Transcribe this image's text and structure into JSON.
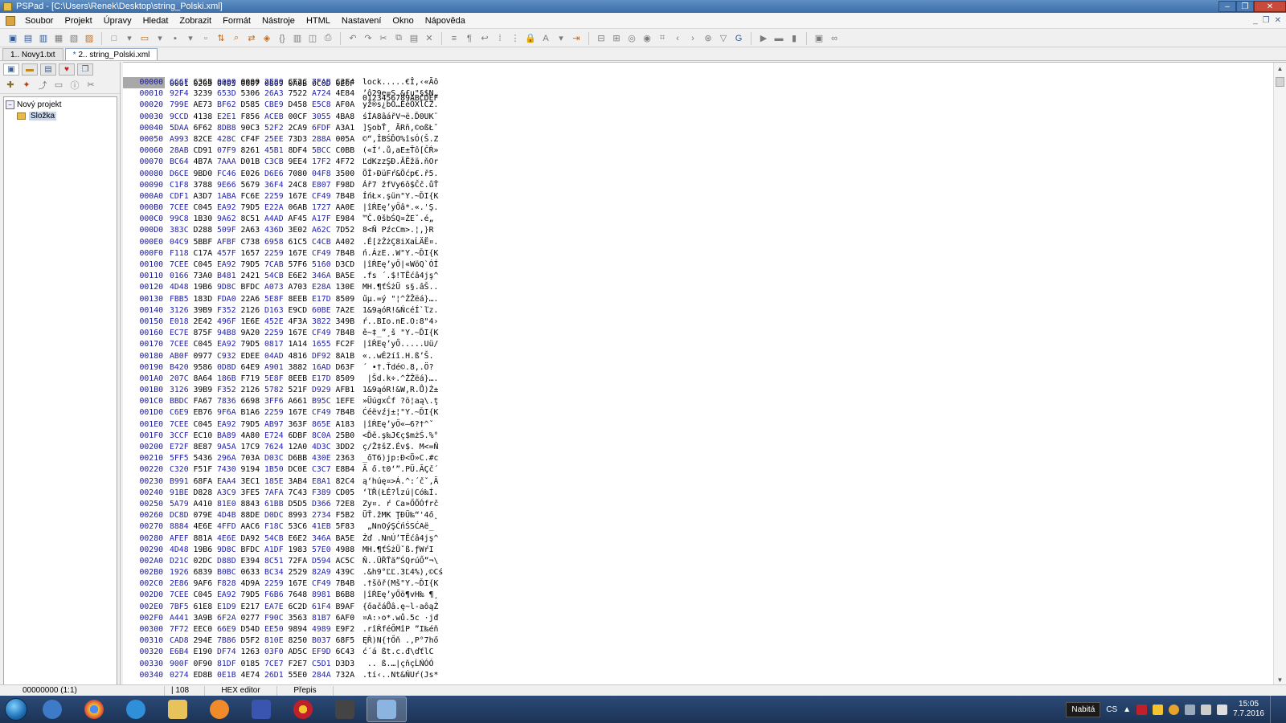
{
  "window": {
    "title": "PSPad - [C:\\Users\\Renek\\Desktop\\string_Polski.xml]",
    "controls": [
      "–",
      "❐",
      "✕"
    ]
  },
  "menu": [
    "Soubor",
    "Projekt",
    "Úpravy",
    "Hledat",
    "Zobrazit",
    "Formát",
    "Nástroje",
    "HTML",
    "Nastavení",
    "Okno",
    "Nápověda"
  ],
  "tabs": [
    {
      "label": "1.. Novy1.txt",
      "modified": false,
      "active": false
    },
    {
      "label": "2.. string_Polski.xml",
      "modified": true,
      "active": true
    }
  ],
  "project_tree": {
    "root": "Nový projekt",
    "child": "Složka"
  },
  "hex": {
    "header_hex": "0001 0203 0405 0607 0809 0A0B 0C0D 0E0F",
    "header_text": "0123456789ABCDEF",
    "rows": [
      {
        "off": "00000",
        "hex": [
          "6C6F",
          "636B",
          "0000",
          "0000",
          "2E80",
          "CE2C",
          "7FAB",
          "C3F4"
        ],
        "text": "lock.....€Î,‹«Ãô"
      },
      {
        "off": "00010",
        "hex": [
          "92F4",
          "3239",
          "653D",
          "5306",
          "26A3",
          "7522",
          "A724",
          "4E84"
        ],
        "text": "’ô29e=S.&£u\"§$N„"
      },
      {
        "off": "00020",
        "hex": [
          "799E",
          "AE73",
          "BF62",
          "D585",
          "CBE9",
          "D458",
          "E5C8",
          "AF0A"
        ],
        "text": "yž®s¿bŐ…ËéÔXĺČŻ."
      },
      {
        "off": "00030",
        "hex": [
          "9CCD",
          "4138",
          "E2E1",
          "F856",
          "ACEB",
          "00CF",
          "3055",
          "4BA8"
        ],
        "text": "śÍA8âářV¬ë.Ď0UK¨"
      },
      {
        "off": "00040",
        "hex": [
          "5DAA",
          "6F62",
          "8DB8",
          "90C3",
          "52F2",
          "2CA9",
          "6FDF",
          "A3A1"
        ],
        "text": "]ŞobŤ¸ ĂRň,©oßŁˇ"
      },
      {
        "off": "00050",
        "hex": [
          "A993",
          "82CE",
          "428C",
          "CF4F",
          "25EE",
          "73D3",
          "288A",
          "005A"
        ],
        "text": "©“‚ÎBŚĎO%îsÓ(Š.Z"
      },
      {
        "off": "00060",
        "hex": [
          "28AB",
          "CD91",
          "07F9",
          "8261",
          "45B1",
          "8DF4",
          "5BCC",
          "C0BB"
        ],
        "text": "(«Í‘.ů‚aE±Ťô[ČŔ»"
      },
      {
        "off": "00070",
        "hex": [
          "BC64",
          "4B7A",
          "7AAA",
          "D01B",
          "C3CB",
          "9EE4",
          "17F2",
          "4F72"
        ],
        "text": "ĽdKzzŞĐ.ĂËžä.ňOr"
      },
      {
        "off": "00080",
        "hex": [
          "D6CE",
          "9BD0",
          "FC46",
          "E026",
          "D6E6",
          "7080",
          "04F8",
          "3500"
        ],
        "text": "ÖÎ›ĐüFŕ&Öćp€.ř5."
      },
      {
        "off": "00090",
        "hex": [
          "C1F8",
          "3788",
          "9E66",
          "5679",
          "36F4",
          "24C8",
          "E807",
          "F98D"
        ],
        "text": "Ář7 žfVy6ô$Čč.ůŤ"
      },
      {
        "off": "000A0",
        "hex": [
          "CDF1",
          "A3D7",
          "1ABA",
          "FC6E",
          "2259",
          "167E",
          "CF49",
          "7B4B"
        ],
        "text": "ÍńŁ×.şün\"Y.~ĎI{K"
      },
      {
        "off": "000B0",
        "hex": [
          "7CEE",
          "C045",
          "EA92",
          "79D5",
          "E22A",
          "06AB",
          "1727",
          "AA0E"
        ],
        "text": "|îŔEę’yŐâ*.«.'Ş."
      },
      {
        "off": "000C0",
        "hex": [
          "99C8",
          "1B30",
          "9A62",
          "8C51",
          "A4AD",
          "AF45",
          "A17F",
          "E984"
        ],
        "text": "™Č.0šbŚQ¤­ŻEˇ.é„"
      },
      {
        "off": "000D0",
        "hex": [
          "383C",
          "D288",
          "509F",
          "2A63",
          "436D",
          "3E02",
          "A62C",
          "7D52"
        ],
        "text": "8<Ň PźcCm>.¦,}R"
      },
      {
        "off": "000E0",
        "hex": [
          "04C9",
          "5BBF",
          "AFBF",
          "C738",
          "6958",
          "61C5",
          "C4CB",
          "A402"
        ],
        "text": ".É[żŻżÇ8iXaĹÄË¤."
      },
      {
        "off": "000F0",
        "hex": [
          "F118",
          "C17A",
          "457F",
          "1657",
          "2259",
          "167E",
          "CF49",
          "7B4B"
        ],
        "text": "ń.ÁzE..W\"Y.~ĎI{K"
      },
      {
        "off": "00100",
        "hex": [
          "7CEE",
          "C045",
          "EA92",
          "79D5",
          "7CAB",
          "57F6",
          "5160",
          "D3CD"
        ],
        "text": "|îŔEę’yŐ|«WöQ`ÓÍ"
      },
      {
        "off": "00110",
        "hex": [
          "0166",
          "73A0",
          "B481",
          "2421",
          "54CB",
          "E6E2",
          "346A",
          "BA5E"
        ],
        "text": ".fs ´.$!TËćâ4jş^"
      },
      {
        "off": "00120",
        "hex": [
          "4D48",
          "19B6",
          "9D8C",
          "BFDC",
          "A073",
          "A703",
          "E28A",
          "130E"
        ],
        "text": "MH.¶ťŚżÜ s§.âŠ.."
      },
      {
        "off": "00130",
        "hex": [
          "FBB5",
          "183D",
          "FDA0",
          "22A6",
          "5E8F",
          "8EEB",
          "E17D",
          "8509"
        ],
        "text": "űµ.=ý \"¦^ŹŽëá}…."
      },
      {
        "off": "00140",
        "hex": [
          "3126",
          "39B9",
          "F352",
          "2126",
          "D163",
          "E9CD",
          "60BE",
          "7A2E"
        ],
        "text": "1&9ąóR!&ŃcéÍ`ľz."
      },
      {
        "off": "00150",
        "hex": [
          "E018",
          "2E42",
          "496F",
          "1E6E",
          "452E",
          "4F3A",
          "3822",
          "349B"
        ],
        "text": "ŕ..BIo.nE.O:8\"4›"
      },
      {
        "off": "00160",
        "hex": [
          "EC7E",
          "875F",
          "94B8",
          "9A20",
          "2259",
          "167E",
          "CF49",
          "7B4B"
        ],
        "text": "ě~‡_”¸š \"Y.~ĎI{K"
      },
      {
        "off": "00170",
        "hex": [
          "7CEE",
          "C045",
          "EA92",
          "79D5",
          "0817",
          "1A14",
          "1655",
          "FC2F"
        ],
        "text": "|îŔEę’yŐ.....Uü/"
      },
      {
        "off": "00180",
        "hex": [
          "AB0F",
          "0977",
          "C932",
          "EDEE",
          "04AD",
          "4816",
          "DF92",
          "8A1B"
        ],
        "text": "«..wÉ2íî.­H.ß’Š."
      },
      {
        "off": "00190",
        "hex": [
          "B420",
          "9586",
          "0D8D",
          "64E9",
          "A901",
          "3882",
          "16AD",
          "D63F"
        ],
        "text": "´ •†.Ťdé©.8‚.­Ö?"
      },
      {
        "off": "001A0",
        "hex": [
          "207C",
          "8A64",
          "186B",
          "F719",
          "5E8F",
          "8EEB",
          "E17D",
          "8509"
        ],
        "text": " |Šd.k÷.^ŹŽëá}…."
      },
      {
        "off": "001B0",
        "hex": [
          "3126",
          "39B9",
          "F352",
          "2126",
          "5782",
          "521F",
          "D929",
          "AFB1"
        ],
        "text": "1&9ąóR!&W‚R.Ů)Ż±"
      },
      {
        "off": "001C0",
        "hex": [
          "BBDC",
          "FA67",
          "7836",
          "6698",
          "3FF6",
          "A661",
          "B95C",
          "1EFE"
        ],
        "text": "»ÜúgxĆf ?ö¦aą\\.ţ"
      },
      {
        "off": "001D0",
        "hex": [
          "C6E9",
          "EB76",
          "9F6A",
          "B1A6",
          "2259",
          "167E",
          "CF49",
          "7B4B"
        ],
        "text": "Ćéëvźj±¦\"Y.~ĎI{K"
      },
      {
        "off": "001E0",
        "hex": [
          "7CEE",
          "C045",
          "EA92",
          "79D5",
          "AB97",
          "363F",
          "865E",
          "A183"
        ],
        "text": "|îŔEę’yŐ«—6?†^ˇ"
      },
      {
        "off": "001F0",
        "hex": [
          "3CCF",
          "EC10",
          "BA89",
          "4A80",
          "E724",
          "6DBF",
          "8C0A",
          "25B0"
        ],
        "text": "<Ďě.ş‰J€ç$mżŚ.%°"
      },
      {
        "off": "00200",
        "hex": [
          "E72F",
          "8E87",
          "9A5A",
          "17C9",
          "7624",
          "12A0",
          "4D3C",
          "3DD2"
        ],
        "text": "ç/Ž‡šZ.Év$. M<=Ň"
      },
      {
        "off": "00210",
        "hex": [
          "5FF5",
          "5436",
          "296A",
          "703A",
          "D03C",
          "D6BB",
          "430E",
          "2363"
        ],
        "text": "_őT6)jp:Đ<Ö»C.#c"
      },
      {
        "off": "00220",
        "hex": [
          "C320",
          "F51F",
          "7430",
          "9194",
          "1B50",
          "DC0E",
          "C3C7",
          "E8B4"
        ],
        "text": "Ă ő.t0‘”.PÜ.ĂÇč´"
      },
      {
        "off": "00230",
        "hex": [
          "B991",
          "68FA",
          "EAA4",
          "3EC1",
          "185E",
          "3AB4",
          "E8A1",
          "82C4"
        ],
        "text": "ą‘húę¤>Á.^:´čˇ‚Ä"
      },
      {
        "off": "00240",
        "hex": [
          "91BE",
          "D828",
          "A3C9",
          "3FE5",
          "7AFA",
          "7C43",
          "F389",
          "CD05"
        ],
        "text": "‘ľŘ(ŁÉ?ĺzú|Có‰Í."
      },
      {
        "off": "00250",
        "hex": [
          "5A79",
          "A410",
          "81E0",
          "8843",
          "61BB",
          "D5D5",
          "D366",
          "72E8"
        ],
        "text": "Zy¤. ŕ Ca»ŐŐÓfrč"
      },
      {
        "off": "00260",
        "hex": [
          "DC8D",
          "079E",
          "4D4B",
          "88DE",
          "D0DC",
          "8993",
          "2734",
          "F5B2"
        ],
        "text": "ÜŤ.žMK ŢĐÜ‰“'4ő˛"
      },
      {
        "off": "00270",
        "hex": [
          "8884",
          "4E6E",
          "4FFD",
          "AAC6",
          "F18C",
          "53C6",
          "41EB",
          "5F83"
        ],
        "text": " „NnOýŞĆńŚSĆAë_ "
      },
      {
        "off": "00280",
        "hex": [
          "AFEF",
          "881A",
          "4E6E",
          "DA92",
          "54CB",
          "E6E2",
          "346A",
          "BA5E"
        ],
        "text": "Żď .NnÚ’TËćâ4jş^"
      },
      {
        "off": "00290",
        "hex": [
          "4D48",
          "19B6",
          "9D8C",
          "BFDC",
          "A1DF",
          "1983",
          "57E0",
          "4988"
        ],
        "text": "MH.¶ťŚżÜˇß.ƒWŕI "
      },
      {
        "off": "002A0",
        "hex": [
          "D21C",
          "02DC",
          "D88D",
          "E394",
          "8C51",
          "72FA",
          "D594",
          "AC5C"
        ],
        "text": "Ň..ÜŘŤă”ŚQrúŐ”¬\\"
      },
      {
        "off": "002B0",
        "hex": [
          "1926",
          "6839",
          "B0BC",
          "0633",
          "BC34",
          "2529",
          "82A9",
          "439C"
        ],
        "text": ".&h9°ĽĽ.3Ľ4%)‚©Cś"
      },
      {
        "off": "002C0",
        "hex": [
          "2E86",
          "9AF6",
          "F828",
          "4D9A",
          "2259",
          "167E",
          "CF49",
          "7B4B"
        ],
        "text": ".†šöř(Mš\"Y.~ĎI{K"
      },
      {
        "off": "002D0",
        "hex": [
          "7CEE",
          "C045",
          "EA92",
          "79D5",
          "F6B6",
          "7648",
          "8981",
          "B6B8"
        ],
        "text": "|îŔEę’yŐö¶vH‰ ¶¸"
      },
      {
        "off": "002E0",
        "hex": [
          "7BF5",
          "61E8",
          "E1D9",
          "E217",
          "EA7E",
          "6C2D",
          "61F4",
          "B9AF"
        ],
        "text": "{őačáŮâ.ę~l-aôąŻ"
      },
      {
        "off": "002F0",
        "hex": [
          "A441",
          "3A9B",
          "6F2A",
          "0277",
          "F90C",
          "3563",
          "81B7",
          "6AF0"
        ],
        "text": "¤A:›o*.wů.5c ·jđ"
      },
      {
        "off": "00300",
        "hex": [
          "7F72",
          "EEC0",
          "66E9",
          "D54D",
          "EE50",
          "9894",
          "4989",
          "E9F2"
        ],
        "text": ".rîŔféŐMîP ”I‰éň"
      },
      {
        "off": "00310",
        "hex": [
          "CAD8",
          "294E",
          "7B86",
          "D5F2",
          "810E",
          "8250",
          "B037",
          "68F5"
        ],
        "text": "ĘŘ)N{†Őň .‚P°7hő"
      },
      {
        "off": "00320",
        "hex": [
          "E6B4",
          "E190",
          "DF74",
          "1263",
          "03F0",
          "AD5C",
          "EF9D",
          "6C43"
        ],
        "text": "ć´á ßt.c.đ­\\ďťlC"
      },
      {
        "off": "00330",
        "hex": [
          "900F",
          "0F90",
          "81DF",
          "0185",
          "7CE7",
          "F2E7",
          "C5D1",
          "D3D3"
        ],
        "text": " .. ß.…|çňçĹŃÓÓ"
      },
      {
        "off": "00340",
        "hex": [
          "0274",
          "ED8B",
          "0E1B",
          "4E74",
          "26D1",
          "55E0",
          "284A",
          "732A"
        ],
        "text": ".tí‹..Nt&ŃUŕ(Js*"
      }
    ]
  },
  "status": {
    "position": "00000000 (1:1)",
    "length": "108",
    "mode": "HEX editor",
    "insert": "Přepis"
  },
  "taskbar": {
    "tooltip": "Nabitá",
    "lang": "CS",
    "time": "15:05",
    "date": "7.7.2016"
  }
}
